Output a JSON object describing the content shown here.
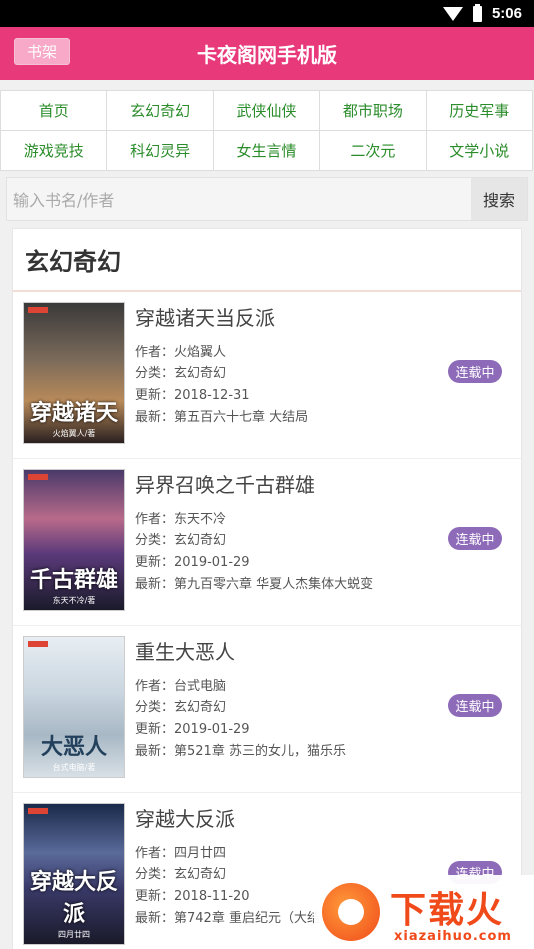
{
  "status_bar": {
    "time": "5:06",
    "icons": [
      "wifi-icon",
      "battery-icon"
    ]
  },
  "header": {
    "title": "卡夜阁网手机版",
    "shelf_label": "书架",
    "accent": "#e8397a"
  },
  "categories": [
    "首页",
    "玄幻奇幻",
    "武侠仙侠",
    "都市职场",
    "历史军事",
    "游戏竞技",
    "科幻灵异",
    "女生言情",
    "二次元",
    "文学小说"
  ],
  "search": {
    "placeholder": "输入书名/作者",
    "button": "搜索"
  },
  "section": {
    "title": "玄幻奇幻"
  },
  "books": [
    {
      "title": "穿越诸天当反派",
      "author": "作者：火焰翼人",
      "category": "分类：玄幻奇幻",
      "updated": "更新：2018-12-31",
      "latest": "最新：第五百六十七章 大结局",
      "status": "连载中",
      "cover_title": "穿越诸天",
      "cover_author": "火焰翼人/著"
    },
    {
      "title": "异界召唤之千古群雄",
      "author": "作者：东天不冷",
      "category": "分类：玄幻奇幻",
      "updated": "更新：2019-01-29",
      "latest": "最新：第九百零六章 华夏人杰集体大蜕变",
      "status": "连载中",
      "cover_title": "千古群雄",
      "cover_author": "东天不冷/著"
    },
    {
      "title": "重生大恶人",
      "author": "作者：台式电脑",
      "category": "分类：玄幻奇幻",
      "updated": "更新：2019-01-29",
      "latest": "最新：第521章 苏三的女儿，猫乐乐",
      "status": "连载中",
      "cover_title": "大恶人",
      "cover_author": "台式电脑/著"
    },
    {
      "title": "穿越大反派",
      "author": "作者：四月廿四",
      "category": "分类：玄幻奇幻",
      "updated": "更新：2018-11-20",
      "latest": "最新：第742章 重启纪元（大结",
      "status": "连载中",
      "cover_title": "穿越大反派",
      "cover_author": "四月廿四"
    }
  ],
  "watermark": {
    "text": "下载火",
    "url": "xiazaihuo.com"
  }
}
